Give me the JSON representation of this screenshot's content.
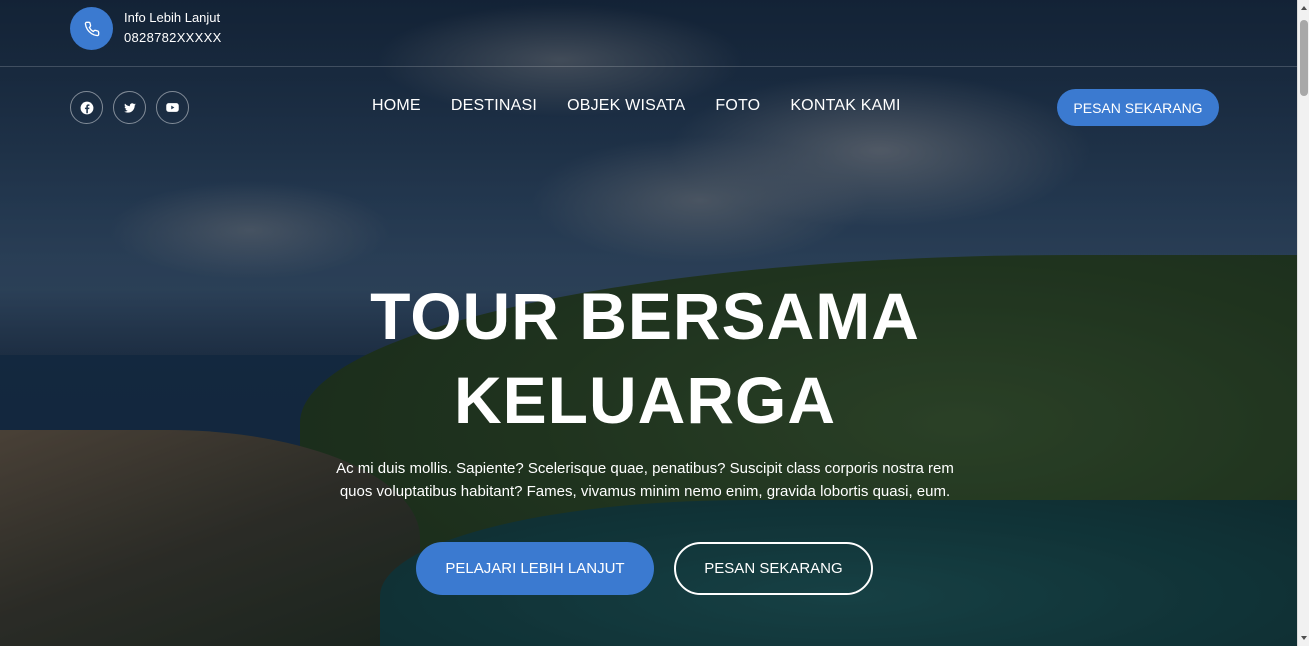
{
  "topbar": {
    "contact_title": "Info Lebih Lanjut",
    "contact_number": "0828782XXXXX",
    "icon": "phone-icon"
  },
  "social": [
    {
      "name": "facebook-icon"
    },
    {
      "name": "twitter-icon"
    },
    {
      "name": "youtube-icon"
    }
  ],
  "nav": {
    "items": [
      "HOME",
      "DESTINASI",
      "OBJEK WISATA",
      "FOTO",
      "KONTAK KAMI"
    ]
  },
  "header_cta": "PESAN SEKARANG",
  "hero": {
    "title_line1": "TOUR BERSAMA",
    "title_line2": "KELUARGA",
    "lead_line1": "Ac mi duis mollis. Sapiente? Scelerisque quae, penatibus? Suscipit class corporis nostra rem",
    "lead_line2": "quos voluptatibus habitant? Fames, vivamus minim nemo enim, gravida lobortis quasi, eum.",
    "primary_button": "PELAJARI LEBIH LANJUT",
    "secondary_button": "PESAN SEKARANG"
  },
  "colors": {
    "accent": "#3b7ad0",
    "text": "#ffffff"
  }
}
